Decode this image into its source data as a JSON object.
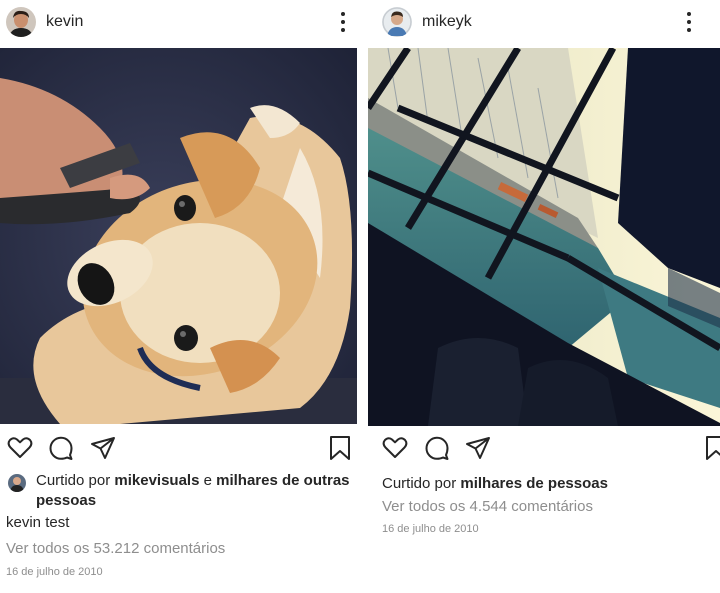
{
  "posts": [
    {
      "username": "kevin",
      "likes": {
        "prefix": "Curtido por",
        "user": "mikevisuals",
        "conjunction": "e",
        "others": "milhares de outras pessoas"
      },
      "caption": {
        "user": "kevin",
        "text": "test"
      },
      "comments_link": "Ver todos os 53.212 comentários",
      "date": "16 de julho de 2010"
    },
    {
      "username": "mikeyk",
      "likes": {
        "prefix": "Curtido por",
        "others": "milhares de pessoas"
      },
      "comments_link": "Ver todos os 4.544 comentários",
      "date": "16 de julho de 2010"
    }
  ],
  "icons": {
    "like": "heart-icon",
    "comment": "comment-icon",
    "share": "paper-plane-icon",
    "save": "bookmark-icon",
    "more": "more-options-icon"
  },
  "colors": {
    "text": "#262626",
    "muted": "#8e8e8e",
    "background": "#ffffff"
  }
}
